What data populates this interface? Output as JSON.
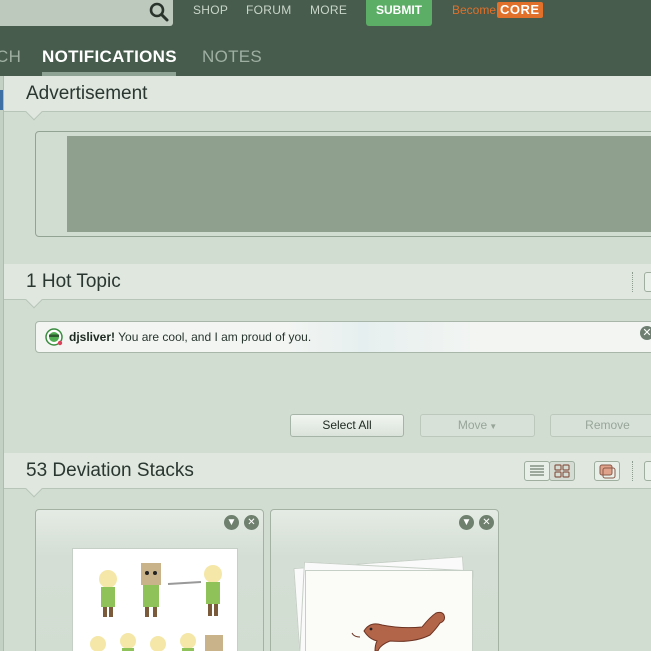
{
  "header": {
    "nav": [
      "SHOP",
      "FORUM",
      "MORE"
    ],
    "submit_label": "SUBMIT",
    "become_label": "Become",
    "core_label": "CORE"
  },
  "tabs": [
    {
      "label": "CH"
    },
    {
      "label": "NOTIFICATIONS",
      "active": true
    },
    {
      "label": "NOTES"
    }
  ],
  "advertisement": {
    "title": "Advertisement"
  },
  "hot_topic": {
    "title": "1 Hot Topic",
    "item": {
      "user": "djsliver!",
      "message": " You are cool, and I am proud of you."
    }
  },
  "actions": {
    "select_all": "Select All",
    "move": "Move",
    "remove": "Remove"
  },
  "stacks": {
    "title": "53 Deviation Stacks"
  },
  "colors": {
    "topbar": "#475c4d",
    "submit": "#5cae67",
    "core": "#e0702a",
    "page": "#d2ddd2"
  }
}
